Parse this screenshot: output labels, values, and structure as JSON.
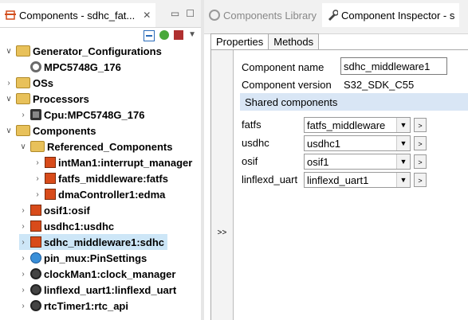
{
  "left_panel": {
    "tab_title": "Components - sdhc_fat...",
    "tree": [
      {
        "label": "Generator_Configurations",
        "level": 0,
        "expanded": true,
        "icon": "folder-icon"
      },
      {
        "label": "MPC5748G_176",
        "level": 1,
        "expanded": null,
        "icon": "gear-icon"
      },
      {
        "label": "OSs",
        "level": 0,
        "expanded": false,
        "icon": "folder-icon"
      },
      {
        "label": "Processors",
        "level": 0,
        "expanded": true,
        "icon": "folder-icon"
      },
      {
        "label": "Cpu:MPC5748G_176",
        "level": 1,
        "expanded": false,
        "icon": "chip-icon"
      },
      {
        "label": "Components",
        "level": 0,
        "expanded": true,
        "icon": "folder-icon"
      },
      {
        "label": "Referenced_Components",
        "level": 1,
        "expanded": true,
        "icon": "folder-icon"
      },
      {
        "label": "intMan1:interrupt_manager",
        "level": 2,
        "expanded": false,
        "icon": "component-icon"
      },
      {
        "label": "fatfs_middleware:fatfs",
        "level": 2,
        "expanded": false,
        "icon": "component-icon"
      },
      {
        "label": "dmaController1:edma",
        "level": 2,
        "expanded": false,
        "icon": "component-icon"
      },
      {
        "label": "osif1:osif",
        "level": 1,
        "expanded": false,
        "icon": "component-icon"
      },
      {
        "label": "usdhc1:usdhc",
        "level": 1,
        "expanded": false,
        "icon": "component-icon"
      },
      {
        "label": "sdhc_middleware1:sdhc",
        "level": 1,
        "expanded": false,
        "icon": "component-icon",
        "selected": true
      },
      {
        "label": "pin_mux:PinSettings",
        "level": 1,
        "expanded": false,
        "icon": "pin-icon"
      },
      {
        "label": "clockMan1:clock_manager",
        "level": 1,
        "expanded": false,
        "icon": "clock-icon"
      },
      {
        "label": "linflexd_uart1:linflexd_uart",
        "level": 1,
        "expanded": false,
        "icon": "clock-icon"
      },
      {
        "label": "rtcTimer1:rtc_api",
        "level": 1,
        "expanded": false,
        "icon": "clock-icon"
      }
    ]
  },
  "right_panel": {
    "tabs": [
      {
        "label": "Components Library",
        "active": false
      },
      {
        "label": "Component Inspector - s",
        "active": true
      }
    ],
    "subtabs": [
      "Properties",
      "Methods"
    ],
    "gutter_label": ">>",
    "component_name_label": "Component name",
    "component_name_value": "sdhc_middleware1",
    "component_version_label": "Component version",
    "component_version_value": "S32_SDK_C55",
    "shared_components_header": "Shared components",
    "shared": [
      {
        "label": "fatfs",
        "value": "fatfs_middleware"
      },
      {
        "label": "usdhc",
        "value": "usdhc1"
      },
      {
        "label": "osif",
        "value": "osif1"
      },
      {
        "label": "linflexd_uart",
        "value": "linflexd_uart1"
      }
    ],
    "dropdown_glyph": "▼",
    "goto_glyph": ">"
  }
}
